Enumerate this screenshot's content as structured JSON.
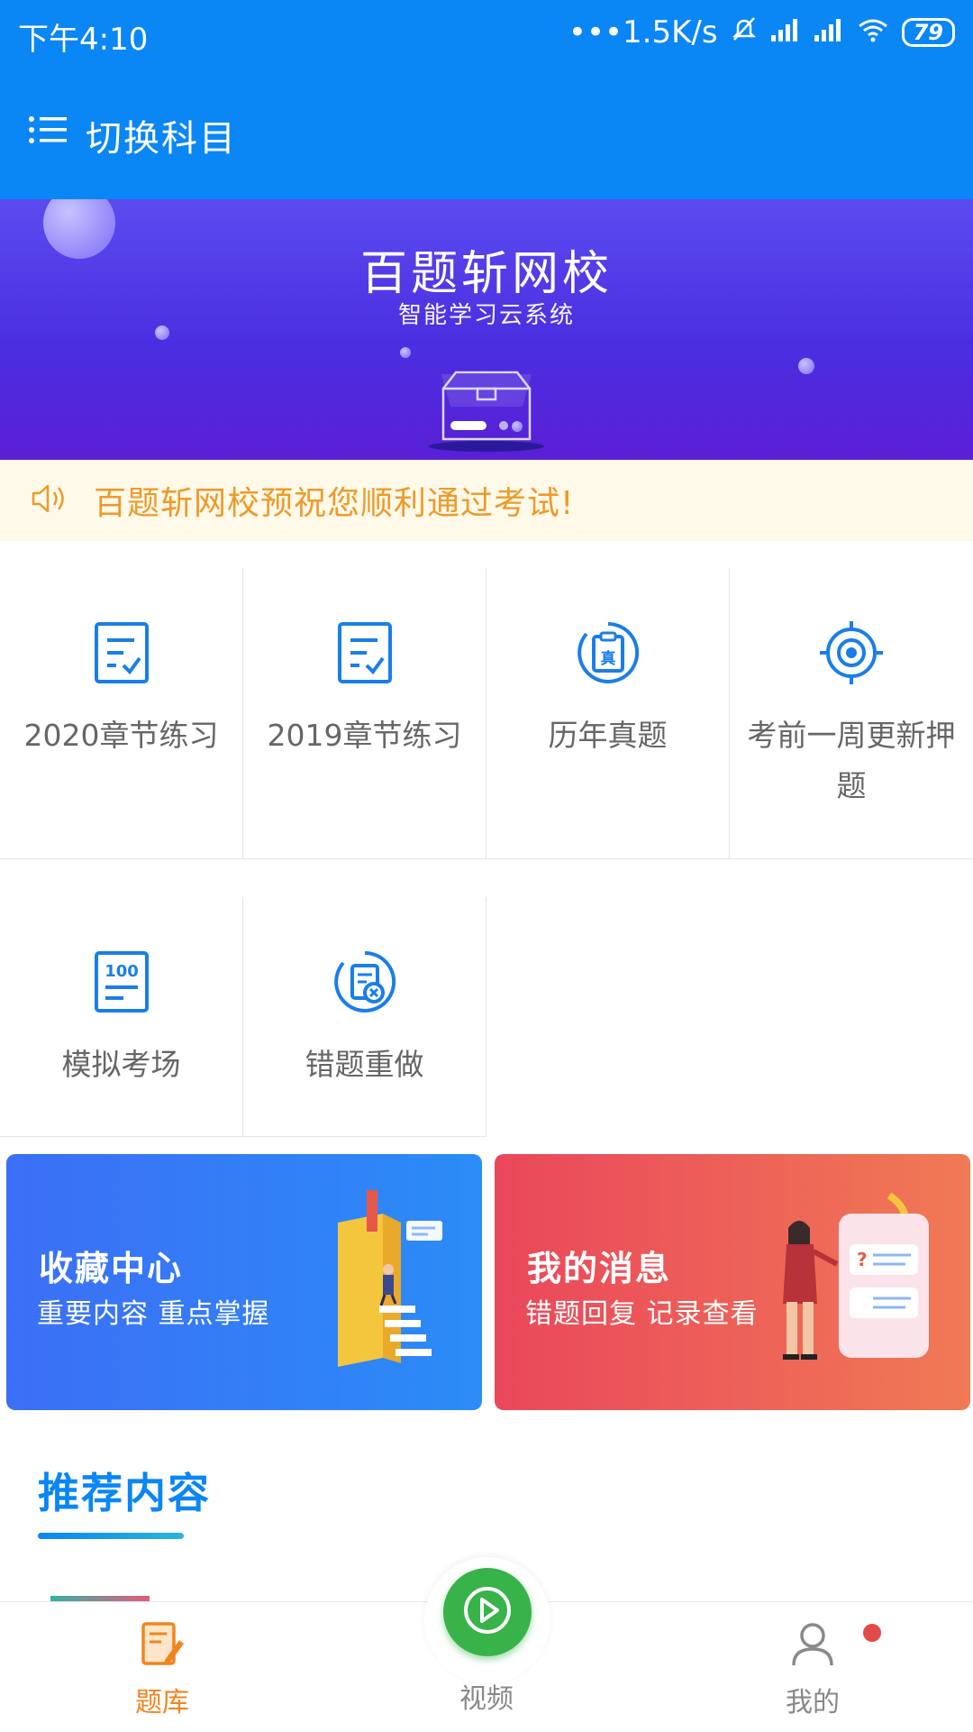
{
  "status_bar": {
    "time": "下午4:10",
    "network_speed": "•••1.5K/s",
    "battery": "79",
    "icons": [
      "mute-icon",
      "signal-icon",
      "signal-icon",
      "wifi-icon",
      "battery-icon"
    ]
  },
  "header": {
    "title": "切换科目",
    "icon": "menu-list-icon"
  },
  "banner": {
    "title": "百题斩网校",
    "subtitle": "智能学习云系统",
    "page_count": 2,
    "active_page": 1
  },
  "notice": {
    "icon": "speaker-icon",
    "text": "百题斩网校预祝您顺利通过考试!"
  },
  "menu": {
    "row1": [
      {
        "label": "2020章节练习",
        "icon": "checklist-icon"
      },
      {
        "label": "2019章节练习",
        "icon": "checklist-icon"
      },
      {
        "label": "历年真题",
        "icon": "real-exam-icon"
      },
      {
        "label": "考前一周更新押题",
        "icon": "target-icon"
      }
    ],
    "row2": [
      {
        "label": "模拟考场",
        "icon": "score-100-icon"
      },
      {
        "label": "错题重做",
        "icon": "wrong-question-icon"
      }
    ],
    "icon_text": {
      "score": "100",
      "real": "真"
    }
  },
  "cards": {
    "favorites": {
      "title": "收藏中心",
      "subtitle": "重要内容 重点掌握"
    },
    "messages": {
      "title": "我的消息",
      "subtitle": "错题回复 记录查看"
    }
  },
  "recommend": {
    "title": "推荐内容"
  },
  "tabbar": {
    "items": [
      {
        "label": "题库",
        "icon": "question-bank-icon",
        "active": true
      },
      {
        "label": "视频",
        "icon": "play-icon",
        "active": false
      },
      {
        "label": "我的",
        "icon": "user-icon",
        "active": false
      }
    ]
  },
  "colors": {
    "primary": "#0a86f5",
    "notice_text": "#ee9a28",
    "tab_active": "#f0851f",
    "video_button": "#37b34a",
    "badge": "#e24a4a"
  }
}
